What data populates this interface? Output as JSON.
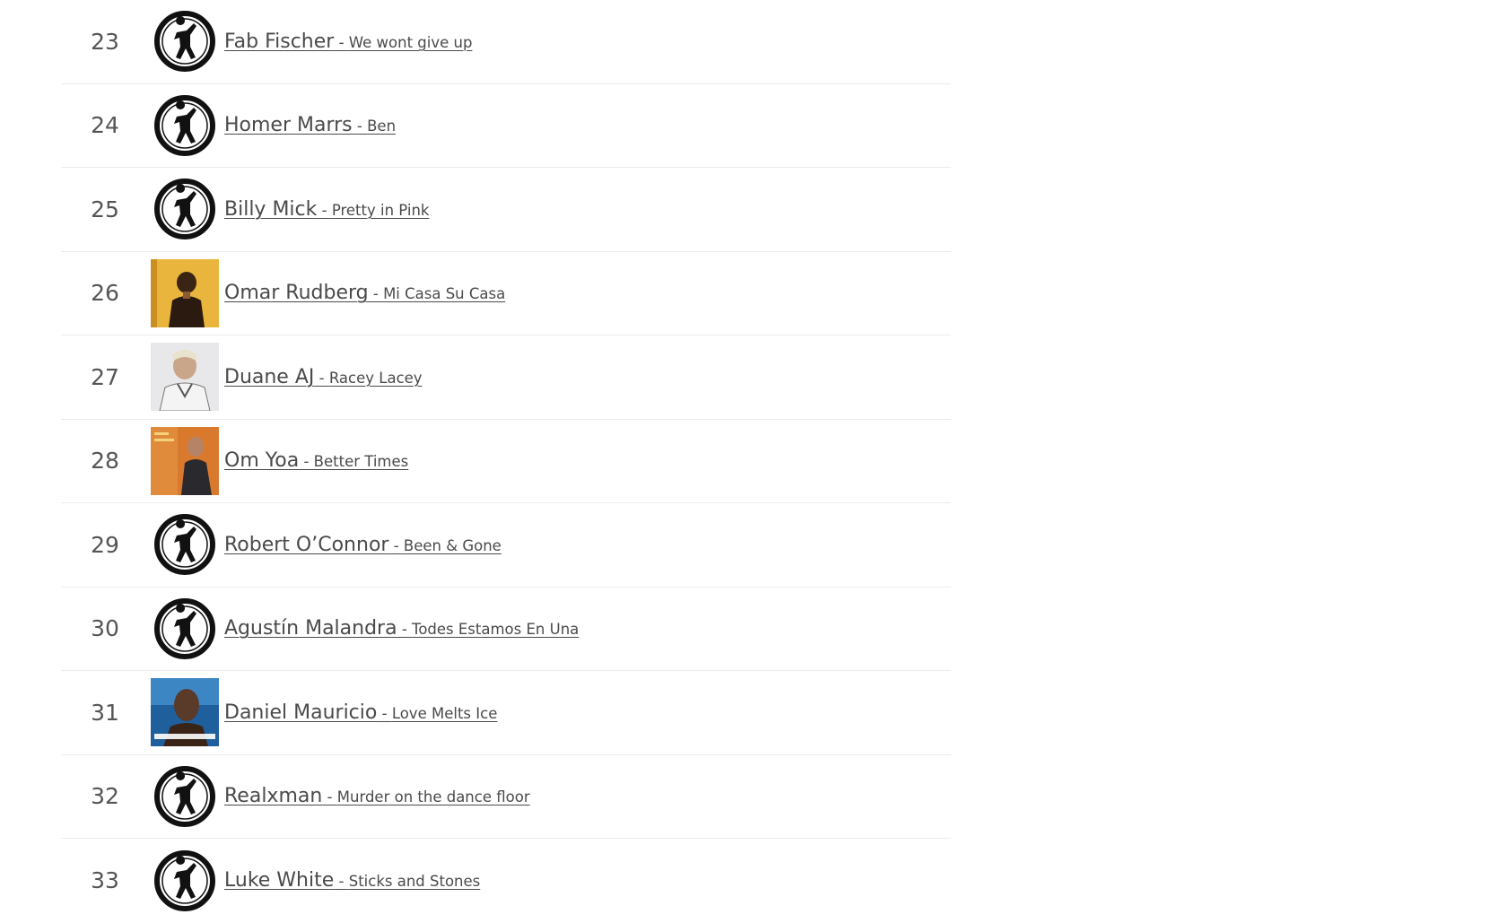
{
  "entries": [
    {
      "rank": "23",
      "artist": "Fab Fischer",
      "sep": " - ",
      "song": "We wont give up",
      "cover": "logo-icon"
    },
    {
      "rank": "24",
      "artist": "Homer Marrs",
      "sep": " - ",
      "song": "Ben",
      "cover": "logo-icon"
    },
    {
      "rank": "25",
      "artist": "Billy Mick",
      "sep": " - ",
      "song": "Pretty in Pink",
      "cover": "logo-icon"
    },
    {
      "rank": "26",
      "artist": "Omar Rudberg",
      "sep": " - ",
      "song": "Mi Casa Su Casa",
      "cover": "album-cover-yellow"
    },
    {
      "rank": "27",
      "artist": "Duane AJ",
      "sep": " - ",
      "song": "Racey Lacey",
      "cover": "album-cover-white"
    },
    {
      "rank": "28",
      "artist": "Om Yoa",
      "sep": " - ",
      "song": "Better Times",
      "cover": "album-cover-orange"
    },
    {
      "rank": "29",
      "artist": "Robert O’Connor",
      "sep": " - ",
      "song": "Been & Gone",
      "cover": "logo-icon"
    },
    {
      "rank": "30",
      "artist": "Agustín Malandra",
      "sep": " - ",
      "song": "Todes Estamos En Una",
      "cover": "logo-icon"
    },
    {
      "rank": "31",
      "artist": "Daniel Mauricio",
      "sep": " - ",
      "song": "Love Melts Ice",
      "cover": "album-cover-blue"
    },
    {
      "rank": "32",
      "artist": "Realxman",
      "sep": " - ",
      "song": "Murder on the dance floor",
      "cover": "logo-icon"
    },
    {
      "rank": "33",
      "artist": "Luke White",
      "sep": " - ",
      "song": "Sticks and Stones",
      "cover": "logo-icon"
    }
  ],
  "colors": {
    "text": "#4a4a4a",
    "divider": "#ececec",
    "cover_yellow": "#e9b53c",
    "cover_orange": "#d9792e",
    "cover_blue": "#1f5f9c"
  }
}
